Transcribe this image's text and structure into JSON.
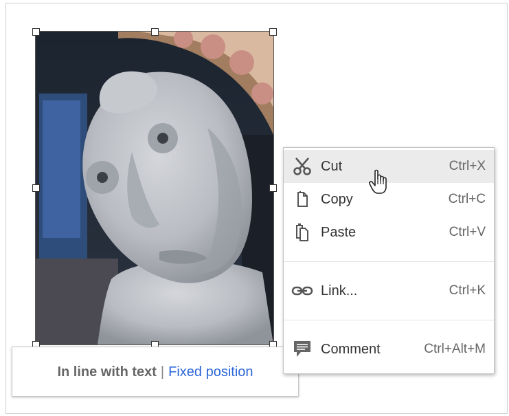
{
  "image": {
    "description_icon": "stone-statue-photo"
  },
  "wrap_bar": {
    "inline_label": "In line with text",
    "separator": "|",
    "fixed_label": "Fixed position"
  },
  "context_menu": {
    "items": [
      {
        "label": "Cut",
        "shortcut": "Ctrl+X",
        "icon": "scissors-icon"
      },
      {
        "label": "Copy",
        "shortcut": "Ctrl+C",
        "icon": "copy-icon"
      },
      {
        "label": "Paste",
        "shortcut": "Ctrl+V",
        "icon": "paste-icon"
      },
      {
        "label": "Link...",
        "shortcut": "Ctrl+K",
        "icon": "link-icon"
      },
      {
        "label": "Comment",
        "shortcut": "Ctrl+Alt+M",
        "icon": "comment-icon"
      }
    ]
  },
  "colors": {
    "link_blue": "#2b66d9",
    "menu_hover": "#ebebeb",
    "icon_gray": "#666666"
  }
}
